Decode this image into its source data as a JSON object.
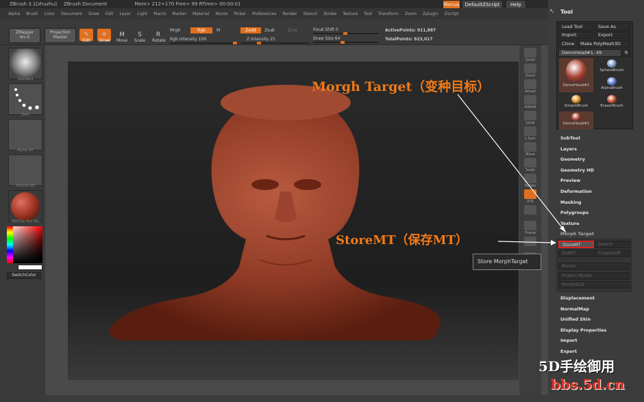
{
  "titlebar": {
    "app": "ZBrush  3.1[zhuzhu]",
    "doc": "ZBrush Document",
    "mem": "Mem> 212+170  Free> 99  RTime> 00:00:01",
    "menus": "Menus",
    "script": "DefaultZScript",
    "help": "Help"
  },
  "menu": [
    "Alpha",
    "Brush",
    "Color",
    "Document",
    "Draw",
    "Edit",
    "Layer",
    "Light",
    "Macro",
    "Marker",
    "Material",
    "Movie",
    "Picker",
    "Preferences",
    "Render",
    "Stencil",
    "Stroke",
    "Texture",
    "Tool",
    "Transform",
    "Zoom",
    "Zplugin",
    "Zscript"
  ],
  "toolbar": {
    "zmapper": "ZMapper",
    "zmapper_sub": "rev-E",
    "projection": "Projection",
    "projection_sub": "Master",
    "edit": "Edit",
    "draw": "Draw",
    "move": "Move",
    "scale": "Scale",
    "rotate": "Rotate",
    "mrgb": "Mrgb",
    "rgb": "Rgb",
    "m": "M",
    "rgb_intensity": "Rgb  Intensity 100",
    "zadd": "Zadd",
    "zsub": "Zsub",
    "zcut": "Zcut",
    "z_intensity": "Z  Intensity 25",
    "focal_shift": "Focal  Shift 0",
    "draw_size": "Draw  Size 64",
    "active_points": "ActivePoints: 911,887",
    "total_points": "TotalPoints: 923,017"
  },
  "lefttray": {
    "standard": "Standard",
    "dots": "Dots",
    "alpha": "Alpha  Off",
    "texture": "Texture  Off",
    "matcap": "MatCap  Red  Wa",
    "switchcolor": "SwitchColor"
  },
  "rightshelf": [
    "Scroll",
    "Zoom",
    "Actual",
    "AAHalf",
    "Local",
    "L.Sym",
    "Move",
    "Scale",
    "Rotate",
    "XYZ",
    "",
    "Frame",
    "",
    "Lasso"
  ],
  "toolpanel": {
    "title": "Tool",
    "load": "Load  Tool",
    "save": "Save  As",
    "import": "Import",
    "export": "Export",
    "clone": "Clone",
    "polymesh": "Make  PolyMesh3D",
    "current": "DemoHead#1. 49",
    "r": "R",
    "brushes": [
      "DemoHead#1",
      "SphereBrush",
      "AlphaBrush",
      "SimpleBrush",
      "EraserBrush",
      "DemoHead#1"
    ],
    "sections": [
      "SubTool",
      "Layers",
      "Geometry",
      "Geometry  HD",
      "Preview",
      "Deformation",
      "Masking",
      "Polygroups",
      "Texture",
      "Morph  Target"
    ],
    "morph": {
      "storemt": "StoreMT",
      "switch": "Switch",
      "delmt": "DelMT",
      "creatediff": "CreateDiff",
      "morph": "Morph",
      "project": "Project  Morph",
      "morphdist": "MorphDist"
    },
    "sections2": [
      "Displacement",
      "NormalMap",
      "Unified  Skin",
      "Display  Properties",
      "Import",
      "Export"
    ]
  },
  "tooltip": "Store  MorphTarget",
  "annotations": {
    "morph_target": "Morgh Target（变种目标）",
    "storemt": "StoreMT（保存MT）",
    "watermark1": "5D手绘御用",
    "watermark2": "bbs.5d.cn"
  },
  "colors": {
    "accent": "#e07020",
    "annot": "#f07a1a",
    "highlight": "#e02020"
  }
}
